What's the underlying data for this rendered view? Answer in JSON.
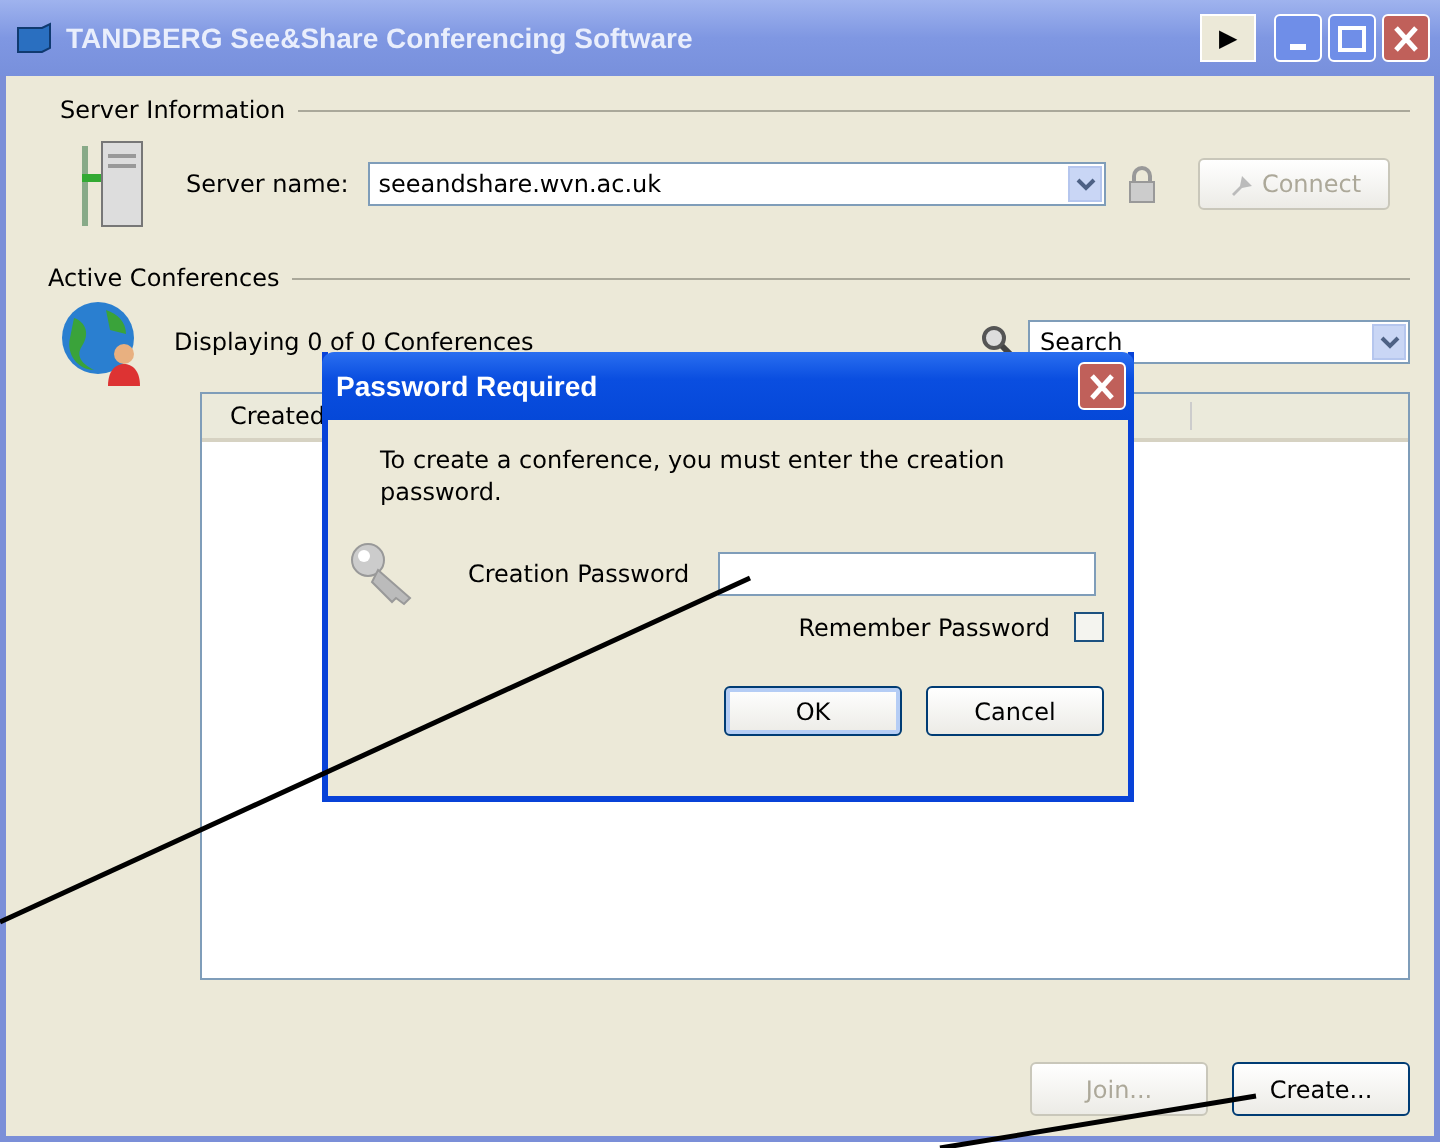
{
  "window": {
    "title": "TANDBERG See&Share Conferencing Software",
    "controls": [
      "▶"
    ]
  },
  "server_information": {
    "legend": "Server Information",
    "label": "Server name:",
    "value": "seeandshare.wvn.ac.uk",
    "connect": {
      "label": "Connect",
      "disabled": true
    }
  },
  "active_conferences": {
    "legend": "Active Conferences",
    "count_text": "Displaying 0 of 0 Conferences",
    "search": {
      "placeholder": "Search"
    },
    "table": {
      "columns": [
        "Created"
      ]
    }
  },
  "buttons": [
    {
      "label": "Join...",
      "disabled": true
    },
    {
      "label": "Create...",
      "disabled": false
    }
  ],
  "dialog": {
    "title": "Password Required",
    "message": "To create a conference, you must enter the creation password.",
    "field_label": "Creation Password",
    "remember": {
      "label": "Remember Password",
      "checked": false
    },
    "buttons": [
      "OK",
      "Cancel"
    ]
  }
}
